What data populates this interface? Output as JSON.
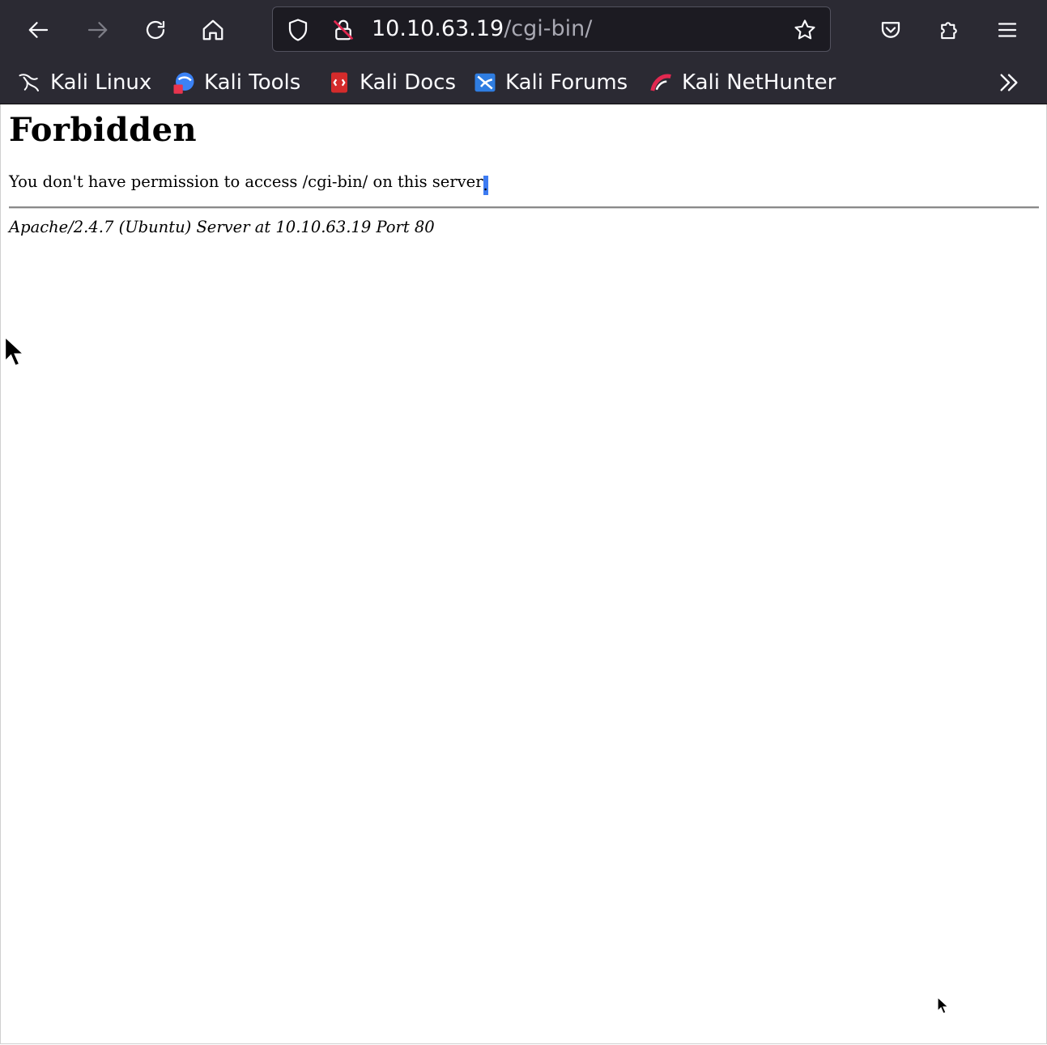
{
  "browser": {
    "url_host": "10.10.63.19",
    "url_path": "/cgi-bin/",
    "bookmarks": [
      {
        "label": "Kali Linux",
        "icon": "kali-dragon-icon"
      },
      {
        "label": "Kali Tools",
        "icon": "kali-tools-icon"
      },
      {
        "label": "Kali Docs",
        "icon": "kali-docs-icon"
      },
      {
        "label": "Kali Forums",
        "icon": "kali-forums-icon"
      },
      {
        "label": "Kali NetHunter",
        "icon": "kali-nethunter-icon"
      }
    ],
    "icons": {
      "back": "back-arrow-icon",
      "forward": "forward-arrow-icon",
      "reload": "reload-icon",
      "home": "home-icon",
      "tracking": "shield-icon",
      "insecure": "insecure-lock-icon",
      "bookmark": "star-icon",
      "pocket": "pocket-icon",
      "extensions": "puzzle-icon",
      "menu": "hamburger-menu-icon",
      "overflow": "chevron-double-right-icon"
    },
    "colors": {
      "chrome": "#2b2a33",
      "urlbar": "#1c1b22",
      "text": "#fbfbfe"
    }
  },
  "page": {
    "heading": "Forbidden",
    "message": "You don't have permission to access /cgi-bin/ on this server",
    "message_end": ".",
    "address": "Apache/2.4.7 (Ubuntu) Server at 10.10.63.19 Port 80"
  }
}
